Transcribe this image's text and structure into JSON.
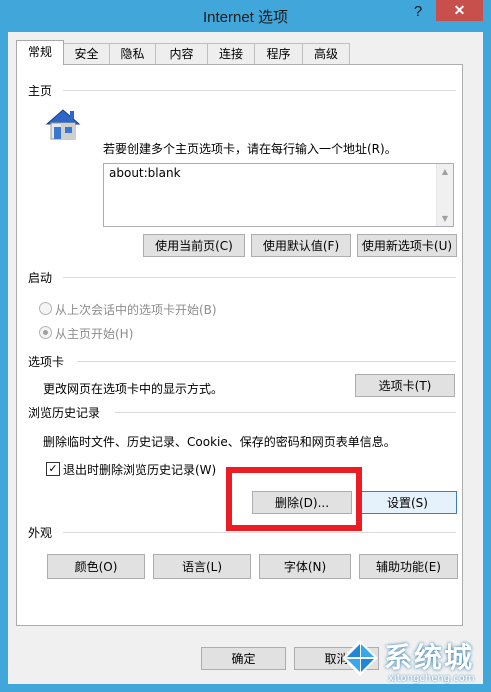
{
  "window": {
    "title": "Internet 选项",
    "help_label": "?",
    "close_label": "✕"
  },
  "tabs": [
    {
      "label": "常规"
    },
    {
      "label": "安全"
    },
    {
      "label": "隐私"
    },
    {
      "label": "内容"
    },
    {
      "label": "连接"
    },
    {
      "label": "程序"
    },
    {
      "label": "高级"
    }
  ],
  "homepage": {
    "section_label": "主页",
    "description": "若要创建多个主页选项卡，请在每行输入一个地址(R)。",
    "textarea_value": "about:blank",
    "buttons": {
      "use_current": "使用当前页(C)",
      "use_default": "使用默认值(F)",
      "use_new_tab": "使用新选项卡(U)"
    }
  },
  "startup": {
    "section_label": "启动",
    "options": [
      {
        "label": "从上次会话中的选项卡开始(B)"
      },
      {
        "label": "从主页开始(H)"
      }
    ]
  },
  "tabs_section": {
    "section_label": "选项卡",
    "description": "更改网页在选项卡中的显示方式。",
    "button": "选项卡(T)"
  },
  "history": {
    "section_label": "浏览历史记录",
    "description": "删除临时文件、历史记录、Cookie、保存的密码和网页表单信息。",
    "checkbox_label": "退出时删除浏览历史记录(W)",
    "delete_button": "删除(D)...",
    "settings_button": "设置(S)"
  },
  "appearance": {
    "section_label": "外观",
    "buttons": {
      "colors": "颜色(O)",
      "languages": "语言(L)",
      "fonts": "字体(N)",
      "accessibility": "辅助功能(E)"
    }
  },
  "footer": {
    "ok": "确定",
    "cancel": "取消"
  },
  "watermark": {
    "brand": "系统城",
    "url": "xitongcheng.com"
  },
  "colors": {
    "titlebar": "#41a6d9",
    "close": "#c7504c",
    "highlight": "#ec1c24"
  },
  "icons": {
    "homepage": "house-icon",
    "check": "checkmark-icon"
  }
}
